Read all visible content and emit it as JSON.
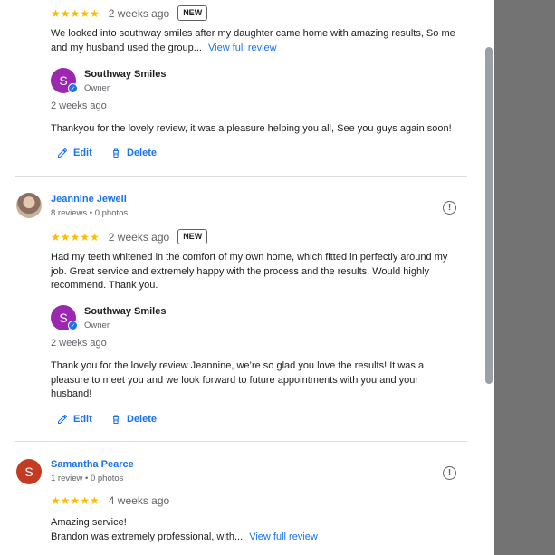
{
  "review1": {
    "stars": "★★★★★",
    "date": "2 weeks ago",
    "badge": "NEW",
    "text": "We looked into southway smiles after my daughter came home with amazing results, So me and my husband used the group...",
    "view_full": "View full review",
    "owner": {
      "initial": "S",
      "name": "Southway Smiles",
      "role": "Owner",
      "time": "2 weeks ago",
      "reply": "Thankyou for the lovely review, it was a pleasure helping you all, See you guys again soon!"
    },
    "edit_label": "Edit",
    "delete_label": "Delete"
  },
  "review2": {
    "name": "Jeannine Jewell",
    "meta": "8 reviews • 0 photos",
    "stars": "★★★★★",
    "date": "2 weeks ago",
    "badge": "NEW",
    "text_lines": [
      "Had my teeth whitened in the comfort of my own home, which fitted in perfectly around my",
      "job. Great service and extremely happy with the process and the results. Would highly",
      "recommend. Thank you."
    ],
    "owner": {
      "initial": "S",
      "name": "Southway Smiles",
      "role": "Owner",
      "time": "2 weeks ago",
      "reply_lines": [
        "Thank you for the lovely review Jeannine, we’re so glad you love the results! It was a",
        "pleasure to meet you and we look forward to future appointments with you and your",
        "husband!"
      ]
    },
    "edit_label": "Edit",
    "delete_label": "Delete"
  },
  "review3": {
    "initial": "S",
    "name": "Samantha Pearce",
    "meta": "1 review • 0 photos",
    "stars": "★★★★★",
    "date": "4 weeks ago",
    "text_line1": "Amazing service!",
    "text_line2": "Brandon was extremely professional, with...",
    "view_full": "View full review"
  },
  "flag_icon_glyph": "!",
  "colors": {
    "link": "#1a73e8",
    "star": "#fbbc04",
    "owner_avatar": "#9c27b0",
    "samantha_avatar": "#c23b22",
    "side_gray": "#737373"
  }
}
